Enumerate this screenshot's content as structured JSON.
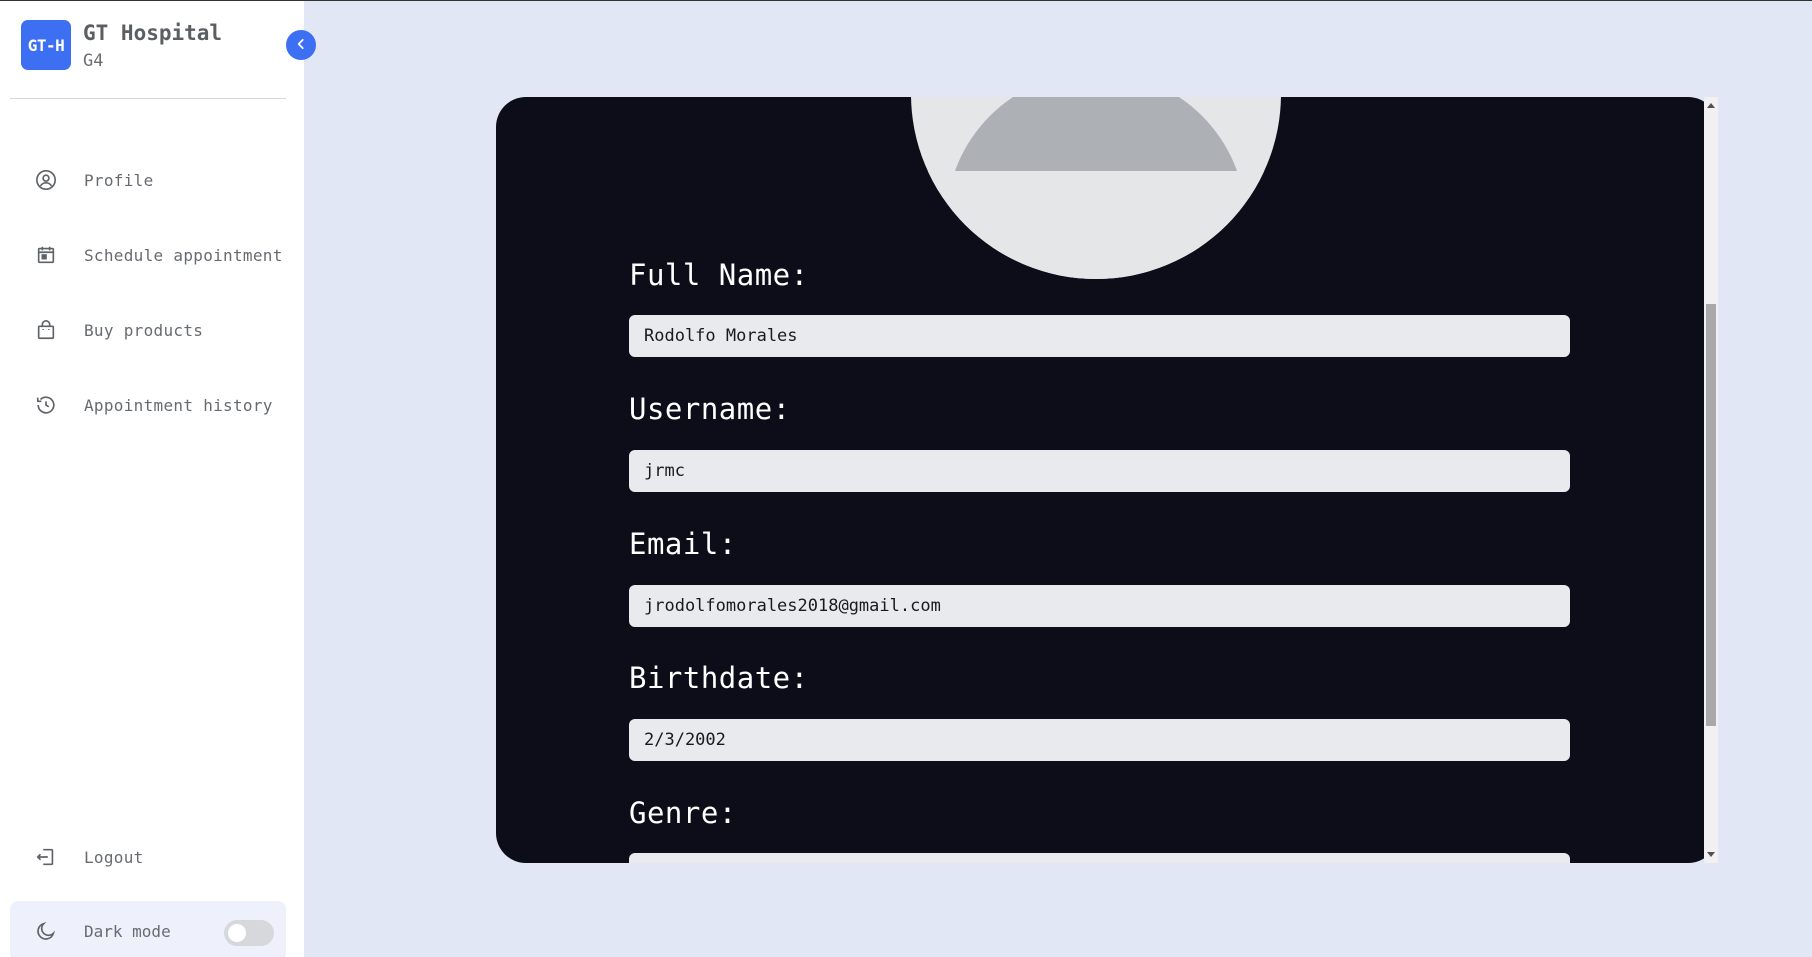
{
  "brand": {
    "logo_text": "GT-H",
    "title": "GT Hospital",
    "subtitle": "G4"
  },
  "sidebar": {
    "items": [
      {
        "label": "Profile",
        "icon": "user-circle-icon"
      },
      {
        "label": "Schedule appointment",
        "icon": "calendar-icon"
      },
      {
        "label": "Buy products",
        "icon": "shopping-bag-icon"
      },
      {
        "label": "Appointment history",
        "icon": "history-icon"
      }
    ],
    "logout_label": "Logout",
    "dark_mode_label": "Dark mode",
    "dark_mode_on": false
  },
  "profile": {
    "fields": [
      {
        "label": "Full Name:",
        "value": "Rodolfo Morales"
      },
      {
        "label": "Username:",
        "value": "jrmc"
      },
      {
        "label": "Email:",
        "value": "jrodolfomorales2018@gmail.com"
      },
      {
        "label": "Birthdate:",
        "value": "2/3/2002"
      },
      {
        "label": "Genre:",
        "value": ""
      }
    ]
  },
  "colors": {
    "accent": "#3d6ff2",
    "card_background": "#0d0d1a",
    "page_background": "#e2e7f5"
  }
}
